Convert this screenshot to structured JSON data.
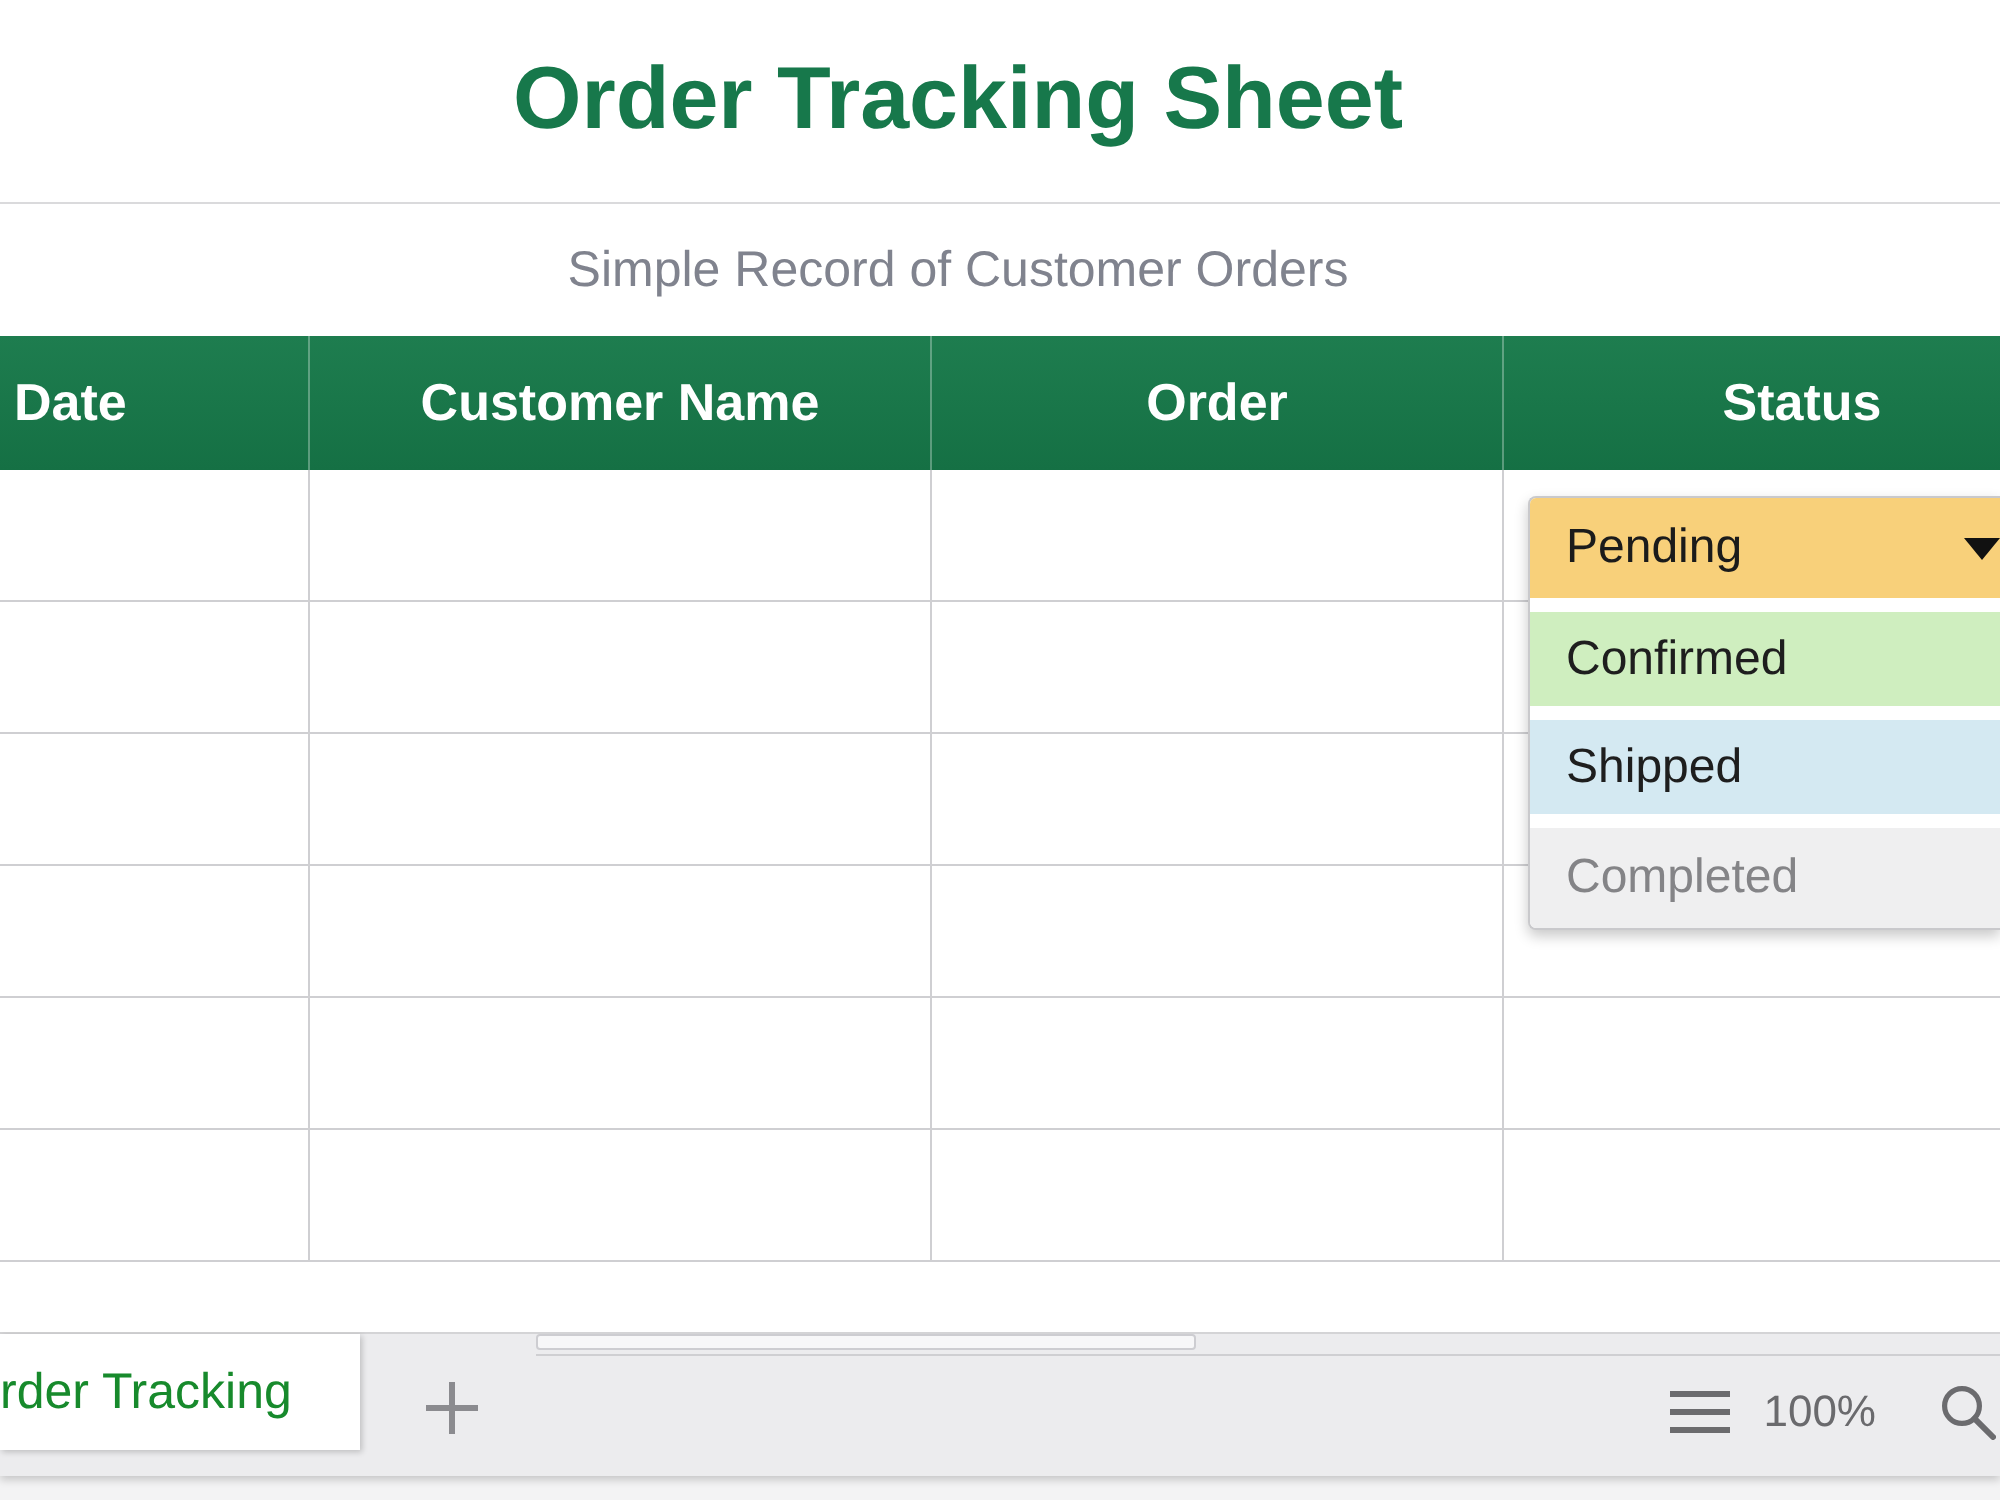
{
  "title": "Order Tracking Sheet",
  "subtitle": "Simple Record of Customer Orders",
  "table": {
    "columns": [
      "Date",
      "Customer Name",
      "Order",
      "Status"
    ],
    "rows": [
      {
        "kind": "blank"
      },
      {
        "kind": "blank"
      },
      {
        "kind": "blank"
      },
      {
        "kind": "blank"
      },
      {
        "kind": "blank"
      },
      {
        "kind": "blank"
      }
    ]
  },
  "status_dropdown": {
    "value": "Pending",
    "color": "#f8d07a",
    "expanded": true,
    "options": [
      {
        "label": "Confirmed",
        "color": "#cfeebf",
        "disabled": false
      },
      {
        "label": "Shipped",
        "color": "#d4e9f2",
        "disabled": false
      },
      {
        "label": "Completed",
        "color": "#efeff0",
        "disabled": true
      }
    ]
  },
  "sheet_tabs": [
    {
      "label": "rder Tracking",
      "selected": true
    }
  ],
  "zoom": "100%"
}
